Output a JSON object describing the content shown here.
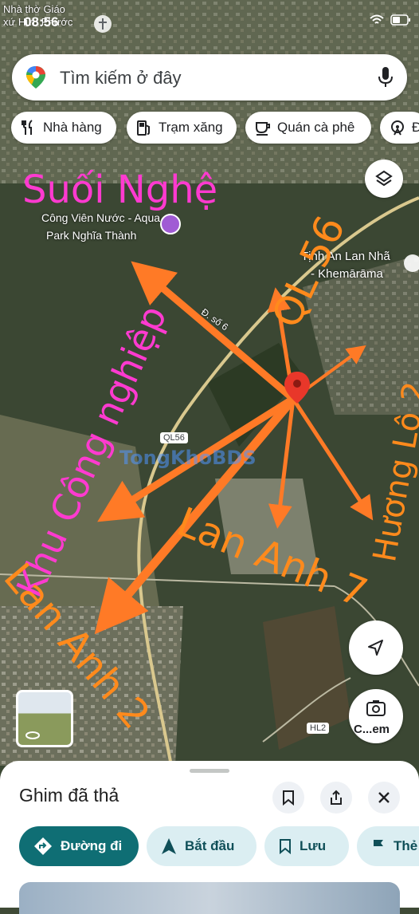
{
  "status_bar": {
    "time": "08:56",
    "poi_line1": "Nhà thờ Giáo",
    "poi_line2": "xứ Hữu Phước",
    "icons": "wifi-icon battery-icon"
  },
  "search": {
    "placeholder": "Tìm kiếm ở đây"
  },
  "chips": [
    {
      "label": "Nhà hàng",
      "icon": "restaurant-icon"
    },
    {
      "label": "Trạm xăng",
      "icon": "gas-station-icon"
    },
    {
      "label": "Quán cà phê",
      "icon": "coffee-icon"
    },
    {
      "label": "Đ",
      "icon": "attraction-icon"
    }
  ],
  "map": {
    "place_labels": [
      "Công Viên Nước - Aqua",
      "Park Nghĩa Thành",
      "Tịnh An Lan Nhã",
      "- Khemārāma",
      "Đ. số 6"
    ],
    "road_badges": [
      "QL56",
      "HL2"
    ],
    "watermark": "TongKhoBDS",
    "annotations": [
      {
        "text": "Suối Nghệ",
        "color": "#ff3ad0"
      },
      {
        "text": "QL 56",
        "color": "#ff8a1c"
      },
      {
        "text": "Hương Lộ 2",
        "color": "#ff8a1c"
      },
      {
        "text": "Khu Công nghiệp",
        "color": "#ff3ad0"
      },
      {
        "text": "Lan Anh 7",
        "color": "#ff8a1c"
      },
      {
        "text": "Lan Anh 2",
        "color": "#ff8a1c"
      }
    ],
    "pin_color": "#e8372a",
    "arrow_color": "#ff7a26"
  },
  "camera_button": {
    "label": "C...em"
  },
  "sheet": {
    "title": "Ghim đã thả",
    "actions": [
      {
        "label": "Đường đi",
        "icon": "directions-icon"
      },
      {
        "label": "Bắt đầu",
        "icon": "navigation-icon"
      },
      {
        "label": "Lưu",
        "icon": "bookmark-icon"
      },
      {
        "label": "Thẻ",
        "icon": "flag-icon"
      }
    ]
  }
}
